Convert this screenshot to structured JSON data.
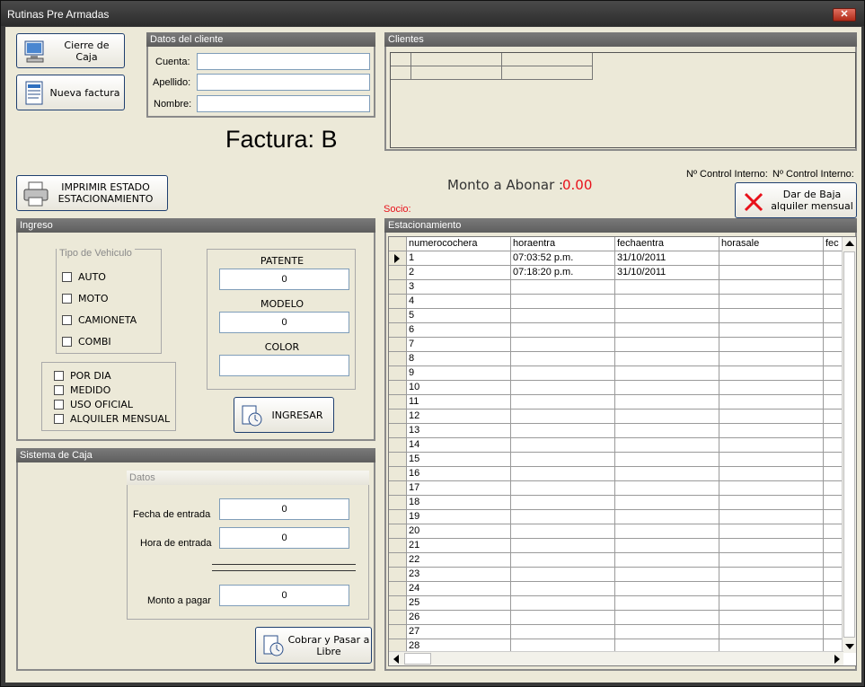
{
  "window": {
    "title": "Rutinas Pre Armadas",
    "close_glyph": "✕"
  },
  "buttons": {
    "cierre_caja": "Cierre de Caja",
    "nueva_factura": "Nueva factura",
    "imprimir": "IMPRIMIR ESTADO ESTACIONAMIENTO",
    "dar_baja": "Dar de Baja alquiler mensual",
    "ingresar": "INGRESAR",
    "cobrar": "Cobrar y Pasar a Libre"
  },
  "datos_cliente": {
    "title": "Datos del cliente",
    "cuenta_label": "Cuenta:",
    "cuenta_value": "",
    "apellido_label": "Apellido:",
    "apellido_value": "",
    "nombre_label": "Nombre:",
    "nombre_value": ""
  },
  "clientes": {
    "title": "Clientes"
  },
  "factura": "Factura: B",
  "monto": {
    "label": "Monto a Abonar :",
    "value": "0.00"
  },
  "control": {
    "label1": "Nº Control Interno:",
    "label2": "Nº Control Interno:"
  },
  "socio": "Socio:",
  "ingreso": {
    "title": "Ingreso",
    "tipo_title": "Tipo de Vehiculo",
    "tipos": [
      "AUTO",
      "MOTO",
      "CAMIONETA",
      "COMBI"
    ],
    "modos": [
      "POR DIA",
      "MEDIDO",
      "USO OFICIAL",
      "ALQUILER MENSUAL"
    ],
    "patente_label": "PATENTE",
    "patente_value": "0",
    "modelo_label": "MODELO",
    "modelo_value": "0",
    "color_label": "COLOR",
    "color_value": ""
  },
  "caja": {
    "title": "Sistema de Caja",
    "datos_title": "Datos",
    "fecha_label": "Fecha de entrada",
    "fecha_value": "0",
    "hora_label": "Hora de entrada",
    "hora_value": "0",
    "monto_label": "Monto a pagar",
    "monto_value": "0"
  },
  "estacionamiento": {
    "title": "Estacionamiento",
    "columns": [
      "numerocochera",
      "horaentra",
      "fechaentra",
      "horasale",
      "fec"
    ],
    "rows": [
      [
        "1",
        "07:03:52 p.m.",
        "31/10/2011",
        "",
        ""
      ],
      [
        "2",
        "07:18:20 p.m.",
        "31/10/2011",
        "",
        ""
      ],
      [
        "3",
        "",
        "",
        "",
        ""
      ],
      [
        "4",
        "",
        "",
        "",
        ""
      ],
      [
        "5",
        "",
        "",
        "",
        ""
      ],
      [
        "6",
        "",
        "",
        "",
        ""
      ],
      [
        "7",
        "",
        "",
        "",
        ""
      ],
      [
        "8",
        "",
        "",
        "",
        ""
      ],
      [
        "9",
        "",
        "",
        "",
        ""
      ],
      [
        "10",
        "",
        "",
        "",
        ""
      ],
      [
        "11",
        "",
        "",
        "",
        ""
      ],
      [
        "12",
        "",
        "",
        "",
        ""
      ],
      [
        "13",
        "",
        "",
        "",
        ""
      ],
      [
        "14",
        "",
        "",
        "",
        ""
      ],
      [
        "15",
        "",
        "",
        "",
        ""
      ],
      [
        "16",
        "",
        "",
        "",
        ""
      ],
      [
        "17",
        "",
        "",
        "",
        ""
      ],
      [
        "18",
        "",
        "",
        "",
        ""
      ],
      [
        "19",
        "",
        "",
        "",
        ""
      ],
      [
        "20",
        "",
        "",
        "",
        ""
      ],
      [
        "21",
        "",
        "",
        "",
        ""
      ],
      [
        "22",
        "",
        "",
        "",
        ""
      ],
      [
        "23",
        "",
        "",
        "",
        ""
      ],
      [
        "24",
        "",
        "",
        "",
        ""
      ],
      [
        "25",
        "",
        "",
        "",
        ""
      ],
      [
        "26",
        "",
        "",
        "",
        ""
      ],
      [
        "27",
        "",
        "",
        "",
        ""
      ],
      [
        "28",
        "",
        "",
        "",
        ""
      ]
    ]
  },
  "colors": {
    "accent_red": "#e8101a",
    "monto_red": "#e8101a",
    "header_gray": "#6a6a6a"
  }
}
